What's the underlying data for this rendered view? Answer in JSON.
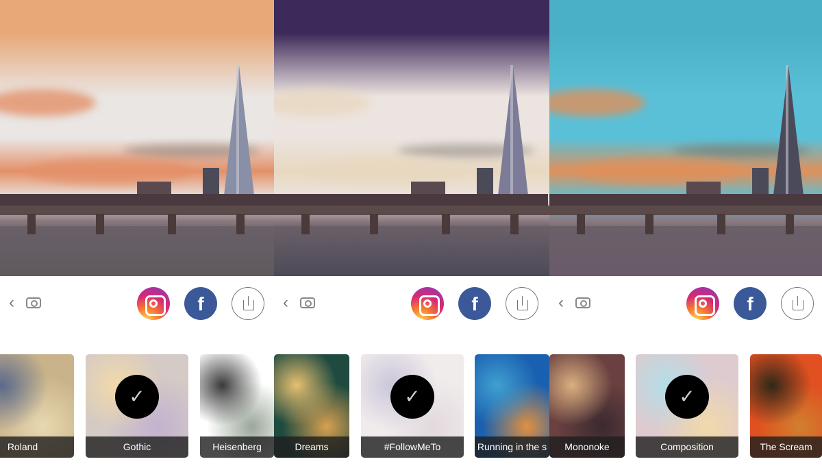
{
  "panels": [
    {
      "style_name": "Gothic",
      "colors": {
        "sky_top": "#e8a878",
        "sky_mid": "#e9e6e4",
        "sky_low": "#e49068",
        "water": "#5f5a5e",
        "shard": "#8a8fa8"
      },
      "toolbar": {
        "back_icon": "chevron-left-icon",
        "camera_icon": "camera-icon",
        "instagram": "instagram-icon",
        "facebook": "f",
        "share": "share-icon"
      },
      "thumbs": [
        {
          "label": "Roland",
          "selected": false,
          "colors": [
            "#c9b38a",
            "#5b6a8c",
            "#e8d8b0"
          ]
        },
        {
          "label": "Gothic",
          "selected": true,
          "colors": [
            "#b7a7a0",
            "#e8c070",
            "#9a7fb0"
          ]
        },
        {
          "label": "Heisenberg",
          "selected": false,
          "colors": [
            "#ffffff",
            "#3a3a3a",
            "#9aa79a"
          ]
        }
      ]
    },
    {
      "style_name": "#FollowMeTo",
      "colors": {
        "sky_top": "#3d2a5a",
        "sky_mid": "#ece4e0",
        "sky_low": "#e8d8c0",
        "water": "#4d4a58",
        "shard": "#7c7c98"
      },
      "toolbar": {
        "back_icon": "chevron-left-icon",
        "camera_icon": "camera-icon",
        "instagram": "instagram-icon",
        "facebook": "f",
        "share": "share-icon"
      },
      "thumbs": [
        {
          "label": "Dreams",
          "selected": false,
          "colors": [
            "#1e4a40",
            "#e8c070",
            "#d8a050"
          ]
        },
        {
          "label": "#FollowMeTo",
          "selected": true,
          "colors": [
            "#e8e0e0",
            "#a8a0c0",
            "#d0c0c8"
          ]
        },
        {
          "label": "Running in the s",
          "selected": false,
          "colors": [
            "#1a60b0",
            "#40a0d0",
            "#e09040"
          ]
        }
      ]
    },
    {
      "style_name": "Composition",
      "colors": {
        "sky_top": "#4ab0c8",
        "sky_mid": "#5ac0d8",
        "sky_low": "#e0905a",
        "water": "#6a5a6a",
        "shard": "#4a4a5a"
      },
      "toolbar": {
        "back_icon": "chevron-left-icon",
        "camera_icon": "camera-icon",
        "instagram": "instagram-icon",
        "facebook": "f",
        "share": "share-icon"
      },
      "thumbs": [
        {
          "label": "Mononoke",
          "selected": false,
          "colors": [
            "#6a4040",
            "#d8b080",
            "#3a2a30"
          ]
        },
        {
          "label": "Composition",
          "selected": true,
          "colors": [
            "#c8a8b0",
            "#80c8d8",
            "#e8c070"
          ]
        },
        {
          "label": "The Scream",
          "selected": false,
          "colors": [
            "#e05020",
            "#302818",
            "#d08030"
          ]
        }
      ]
    }
  ],
  "check_glyph": "✓"
}
